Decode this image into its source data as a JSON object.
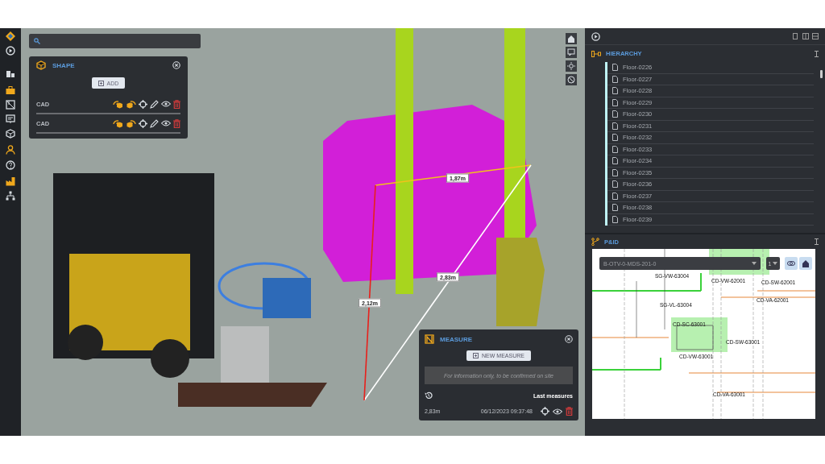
{
  "shape_panel": {
    "title": "SHAPE",
    "add_button": "ADD",
    "items": [
      {
        "label": "CAD"
      },
      {
        "label": "CAD"
      }
    ]
  },
  "viewport": {
    "measurements": [
      {
        "label": "1,87m",
        "color": "#f2c21b"
      },
      {
        "label": "2,83m",
        "color": "#ffffff"
      },
      {
        "label": "2,12m",
        "color": "#e8201c"
      }
    ]
  },
  "measure_panel": {
    "title": "MEASURE",
    "new_button": "NEW MEASURE",
    "notice": "For information only, to be confirmed on site",
    "history_label": "Last measures",
    "entries": [
      {
        "value": "2,83m",
        "date": "06/12/2023 09:37:48"
      }
    ]
  },
  "hierarchy": {
    "title": "HIERARCHY",
    "items": [
      {
        "label": "Floor-0226"
      },
      {
        "label": "Floor-0227"
      },
      {
        "label": "Floor-0228"
      },
      {
        "label": "Floor-0229"
      },
      {
        "label": "Floor-0230"
      },
      {
        "label": "Floor-0231"
      },
      {
        "label": "Floor-0232"
      },
      {
        "label": "Floor-0233"
      },
      {
        "label": "Floor-0234"
      },
      {
        "label": "Floor-0235"
      },
      {
        "label": "Floor-0236"
      },
      {
        "label": "Floor-0237"
      },
      {
        "label": "Floor-0238"
      },
      {
        "label": "Floor-0239"
      }
    ]
  },
  "pid": {
    "title": "P&ID",
    "document": "B-OTV-0-MDS-201-0",
    "page": "1",
    "labels": [
      "SG-VW-63004",
      "CD-VW-62001",
      "CD-SW-62001",
      "CD-VA-62001",
      "SG-VL-63004",
      "CD-SC-63001",
      "CD-SW-63001",
      "CD-VW-63001",
      "CD-VA-63001"
    ]
  }
}
